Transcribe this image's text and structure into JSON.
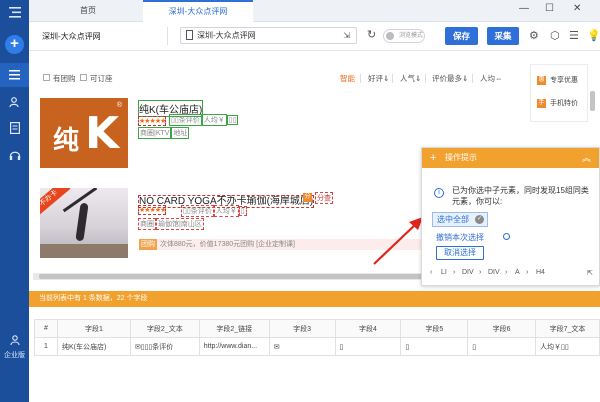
{
  "tabs": {
    "home": "首页",
    "active": "深圳-大众点评网"
  },
  "toolbar": {
    "title": "深圳-大众点评网",
    "url": "深圳-大众点评网",
    "toggle_label": "浏览模式",
    "save": "保存",
    "collect": "采集"
  },
  "rail": {
    "enterprise": "企业版"
  },
  "filters": {
    "has_deal": "有团购",
    "reservable": "可订座",
    "sort_smart": "智能",
    "sort_rating": "好评⇓",
    "sort_popularity": "人气⇓",
    "sort_reviews": "评价最多⇓",
    "sort_price": "人均⇔"
  },
  "listings": [
    {
      "name": "纯K(车公庙店)",
      "stars": "★★★★★",
      "meta": [
        "条评价",
        "人均￥"
      ],
      "meta2": [
        "商圈|KTV",
        "地址"
      ]
    },
    {
      "name": "NO CARD YOGA不办卡瑜伽(海岸城店)",
      "badge": "分",
      "stars": "★★★★★",
      "meta": [
        "条评价",
        "人均￥"
      ],
      "meta2": [
        "商圈",
        "瑜伽馆|南山区"
      ],
      "promo_tag": "团购",
      "promo_text": "次体880元，价值17380元团购 [企业定制课]",
      "ribbon": "不办卡"
    }
  ],
  "sidecard": {
    "item1": "专享优惠",
    "item2": "手机特价"
  },
  "popup": {
    "title": "操作提示",
    "message": "已为你选中子元素，同时发现15组同类元素，你可以:",
    "select_all": "选中全部",
    "undo": "撤销本次选择",
    "cancel": "取消选择",
    "path": [
      "LI",
      "DIV",
      "DIV",
      "A",
      "H4"
    ]
  },
  "data_panel": {
    "summary": "当前列表中有 1 条数据，22 个字段",
    "columns": [
      "#",
      "字段1",
      "字段2_文本",
      "字段2_链接",
      "字段3",
      "字段4",
      "字段5",
      "字段6",
      "字段7_文本"
    ],
    "rows": [
      [
        "1",
        "纯K(车公庙店)",
        "✉▯▯▯条评价",
        "http://www.dian...",
        "✉",
        "▯",
        "▯",
        "▯",
        "人均￥▯▯"
      ]
    ]
  }
}
